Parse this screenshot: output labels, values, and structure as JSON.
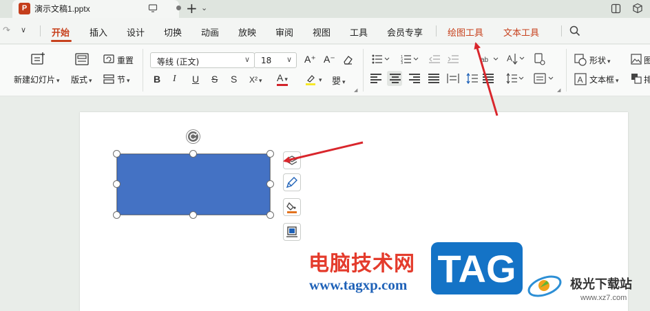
{
  "title_bar": {
    "ppt_logo_letter": "P",
    "doc_name": "演示文稿1.pptx",
    "new_tab_symbol": "+",
    "new_tab_arrow": "⌄"
  },
  "menu": {
    "items": [
      "开始",
      "插入",
      "设计",
      "切换",
      "动画",
      "放映",
      "审阅",
      "视图",
      "工具",
      "会员专享"
    ],
    "context_items": [
      "绘图工具",
      "文本工具"
    ],
    "active": "开始"
  },
  "ribbon": {
    "new_slide": "新建幻灯片",
    "layout": "版式",
    "reset": "重置",
    "section": "节",
    "font_name": "等线 (正文)",
    "font_size": "18",
    "shape": "形状",
    "textbox": "文本框",
    "cut_label_1": "图",
    "cut_label_2": "排",
    "format_glyphs": [
      "B",
      "I",
      "U",
      "S",
      "S",
      "X²",
      "A",
      "A",
      "嬰"
    ],
    "font_size_buttons": [
      "A⁺",
      "A⁻"
    ]
  },
  "watermark": {
    "site_cn": "电脑技术网",
    "site_url": "www.tagxp.com",
    "tag_logo": "TAG",
    "xz_name": "极光下载站",
    "xz_url": "www.xz7.com"
  },
  "colors": {
    "accent": "#c7411d",
    "shape_fill": "#4472c4",
    "annotation_arrow": "#d9262c",
    "tag_blue": "#1473c6"
  }
}
